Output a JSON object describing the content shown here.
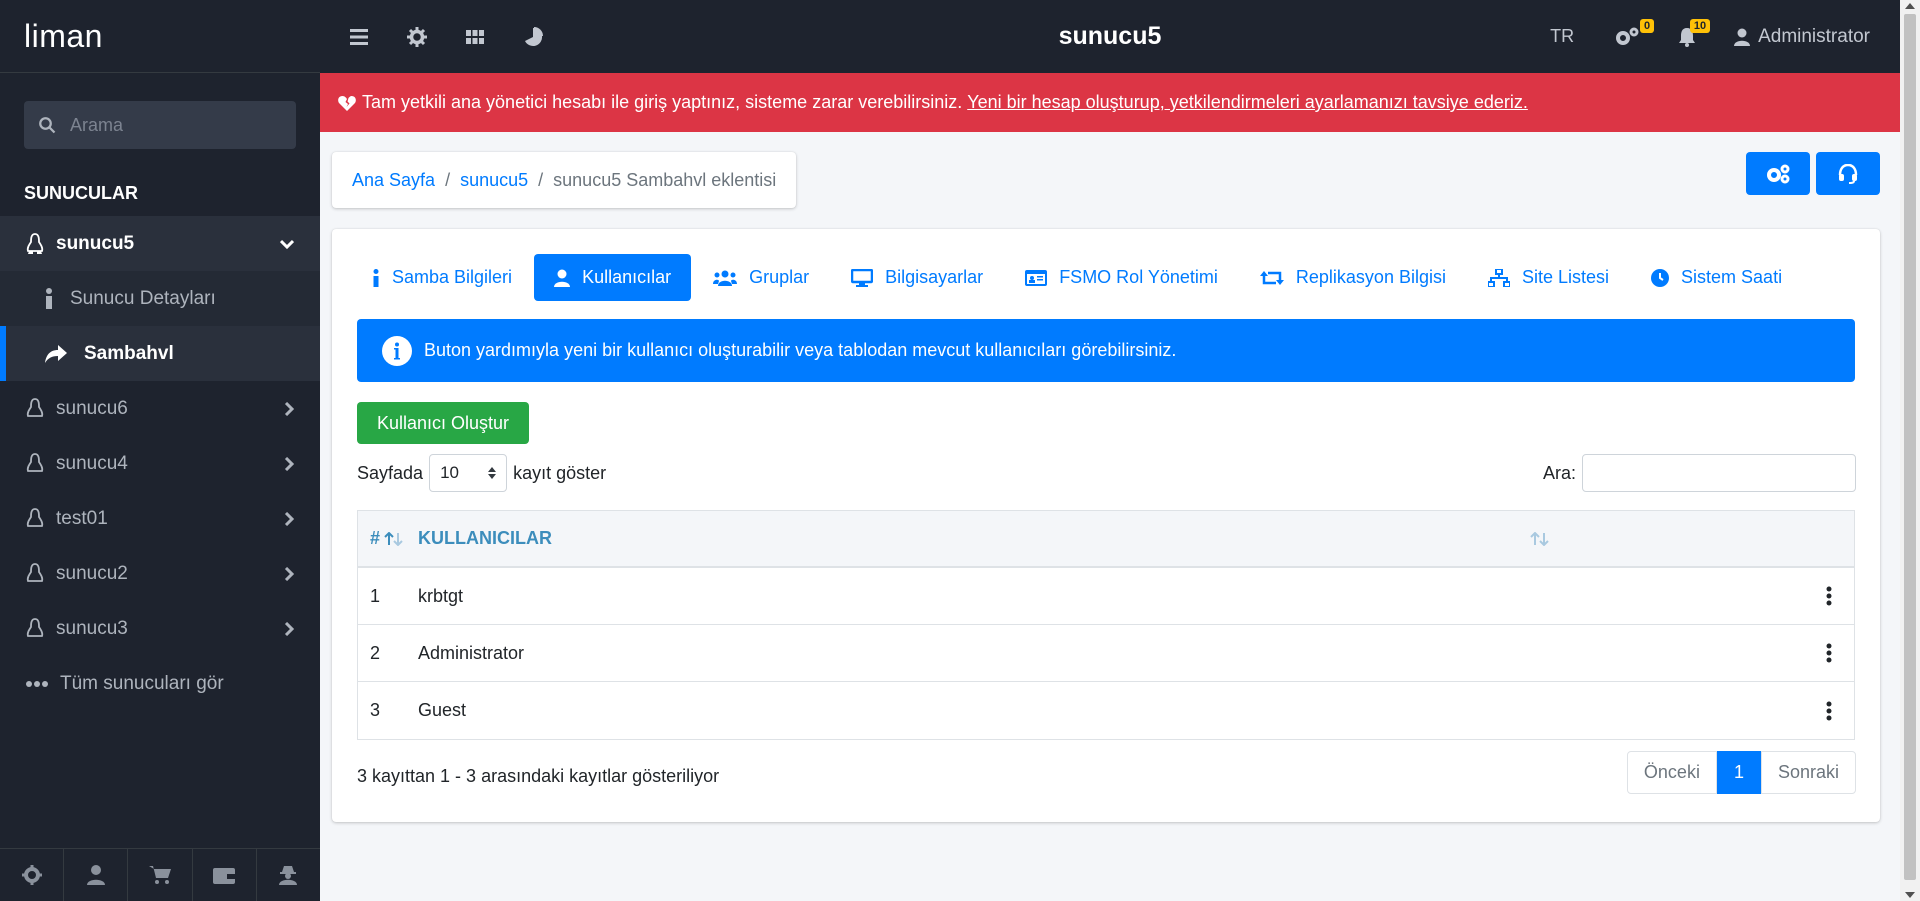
{
  "app": {
    "brand": "liman",
    "server_title": "sunucu5"
  },
  "sidebar": {
    "search_placeholder": "Arama",
    "section": "SUNUCULAR",
    "servers": [
      {
        "label": "sunucu5",
        "expanded": true
      },
      {
        "label": "sunucu6"
      },
      {
        "label": "sunucu4"
      },
      {
        "label": "test01"
      },
      {
        "label": "sunucu2"
      },
      {
        "label": "sunucu3"
      }
    ],
    "subitems": [
      {
        "label": "Sunucu Detayları"
      },
      {
        "label": "Sambahvl"
      }
    ],
    "see_all": "Tüm sunucuları gör"
  },
  "topbar": {
    "lang": "TR",
    "tasks_badge": "0",
    "notifications_badge": "10",
    "user": "Administrator"
  },
  "alert": {
    "text": "Tam yetkili ana yönetici hesabı ile giriş yaptınız, sisteme zarar verebilirsiniz.",
    "link": "Yeni bir hesap oluşturup, yetkilendirmeleri ayarlamanızı tavsiye ederiz."
  },
  "breadcrumb": {
    "home": "Ana Sayfa",
    "server": "sunucu5",
    "current": "sunucu5 Sambahvl eklentisi"
  },
  "tabs": [
    {
      "label": "Samba Bilgileri",
      "icon": "info-icon"
    },
    {
      "label": "Kullanıcılar",
      "icon": "user-icon",
      "active": true
    },
    {
      "label": "Gruplar",
      "icon": "users-icon"
    },
    {
      "label": "Bilgisayarlar",
      "icon": "desktop-icon"
    },
    {
      "label": "FSMO Rol Yönetimi",
      "icon": "id-card-icon"
    },
    {
      "label": "Replikasyon Bilgisi",
      "icon": "retweet-icon"
    },
    {
      "label": "Site Listesi",
      "icon": "sitemap-icon"
    },
    {
      "label": "Sistem Saati",
      "icon": "clock-icon"
    }
  ],
  "info_text": "Buton yardımıyla yeni bir kullanıcı oluşturabilir veya tablodan mevcut kullanıcıları görebilirsiniz.",
  "create_button": "Kullanıcı Oluştur",
  "table": {
    "length_prefix": "Sayfada",
    "length_value": "10",
    "length_suffix": "kayıt göster",
    "search_label": "Ara:",
    "columns": [
      "#",
      "KULLANICILAR"
    ],
    "rows": [
      {
        "num": "1",
        "name": "krbtgt"
      },
      {
        "num": "2",
        "name": "Administrator"
      },
      {
        "num": "3",
        "name": "Guest"
      }
    ],
    "info": "3 kayıttan 1 - 3 arasındaki kayıtlar gösteriliyor",
    "prev": "Önceki",
    "page": "1",
    "next": "Sonraki"
  },
  "colors": {
    "primary": "#007bff",
    "danger": "#dc3545",
    "success": "#28a745",
    "sidebar_bg": "#1e232e"
  }
}
